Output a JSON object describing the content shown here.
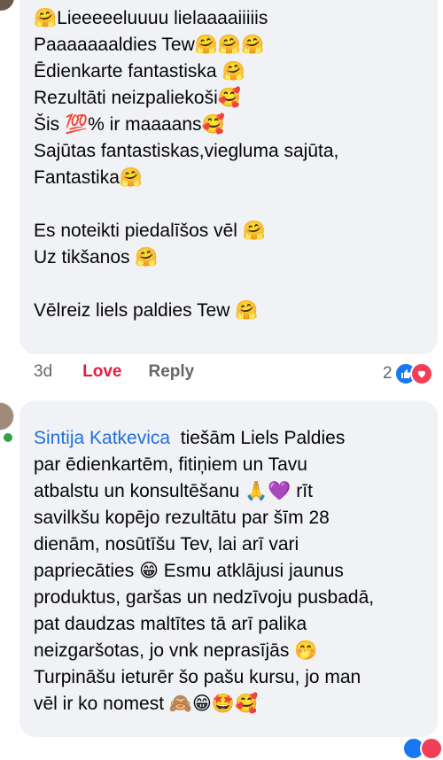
{
  "comment1": {
    "lines": [
      "🤗Lieeeeeluuuu lielaaaaiiiiis",
      "Paaaaaaaldies Tew🤗🤗🤗",
      "Ēdienkarte fantastiska 🤗",
      "Rezultāti neizpaliekoši🥰",
      "Šis 💯% ir maaaans🥰",
      "Sajūtas fantastiskas,viegluma sajūta,",
      "Fantastika🤗",
      "",
      "Es noteikti piedalīšos vēl 🤗",
      "Uz tikšanos 🤗",
      "",
      "Vēlreiz liels paldies Tew 🤗"
    ],
    "time": "3d",
    "love": "Love",
    "reply": "Reply",
    "reaction_count": "2",
    "reaction_icons": [
      "like-icon",
      "love-icon"
    ]
  },
  "comment2": {
    "author": "Sintija Katkevica",
    "first_line_rest": "tiešām Liels Paldies",
    "lines": [
      "par ēdienkartēm, fitiņiem un Tavu",
      "atbalstu un konsultēšanu 🙏💜 rīt",
      "savilkšu kopējo rezultātu par šīm 28",
      "dienām, nosūtīšu Tev, lai arī vari",
      "papriecāties 😁 Esmu atklājusi jaunus",
      "produktus, garšas un nedzīvoju pusbadā,",
      "pat daudzas maltītes tā arī palika",
      "neizgaršotas, jo vnk neprasījās 🤭",
      "Turpināšu ieturēr šo pašu kursu, jo man",
      "vēl ir ko nomest 🙈😁🤩🥰"
    ]
  },
  "colors": {
    "bubble": "#f0f2f5",
    "link": "#216fdb",
    "love": "#e41e3f",
    "meta": "#65676b"
  }
}
